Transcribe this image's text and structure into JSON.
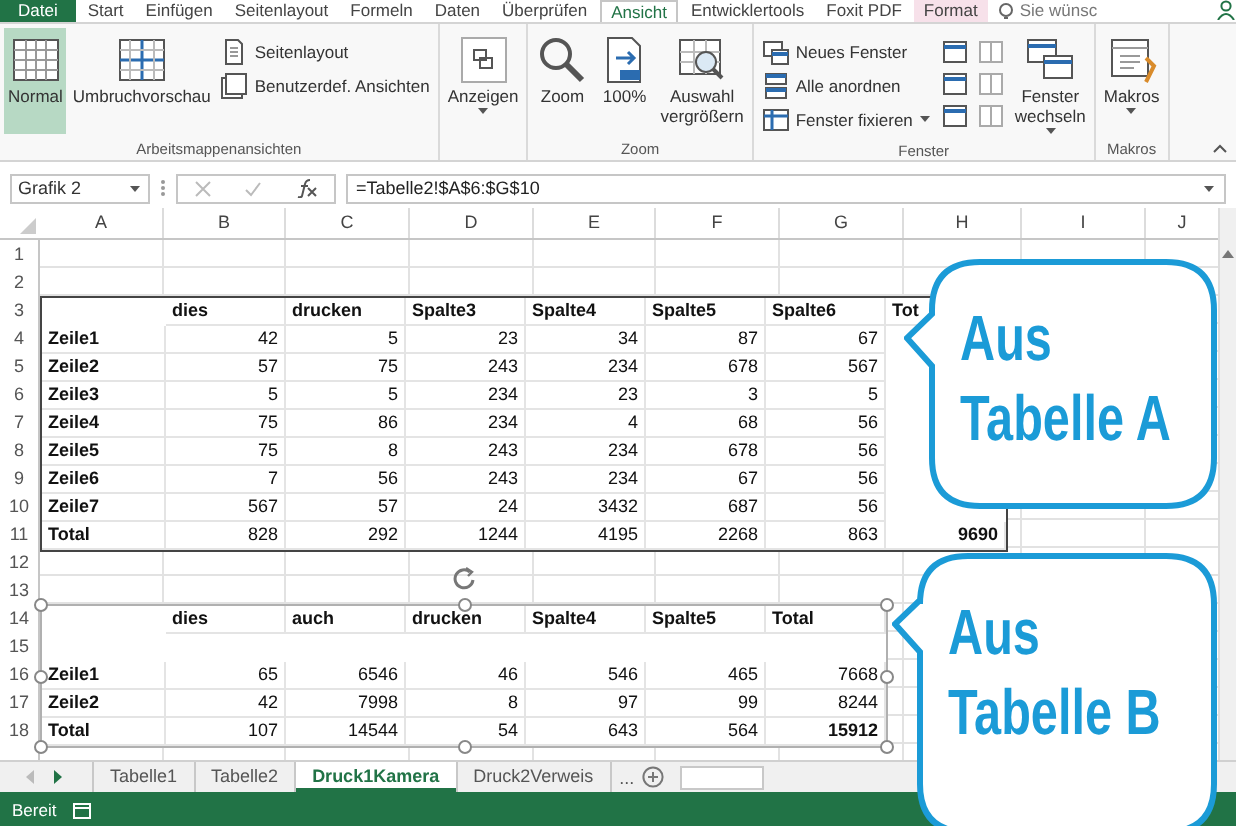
{
  "ribbon_tabs": [
    {
      "label": "Datei",
      "kind": "file",
      "selected": false
    },
    {
      "label": "Start",
      "kind": "normal",
      "selected": false
    },
    {
      "label": "Einfügen",
      "kind": "normal",
      "selected": false
    },
    {
      "label": "Seitenlayout",
      "kind": "normal",
      "selected": false
    },
    {
      "label": "Formeln",
      "kind": "normal",
      "selected": false
    },
    {
      "label": "Daten",
      "kind": "normal",
      "selected": false
    },
    {
      "label": "Überprüfen",
      "kind": "normal",
      "selected": false
    },
    {
      "label": "Ansicht",
      "kind": "normal",
      "selected": true
    },
    {
      "label": "Entwicklertools",
      "kind": "normal",
      "selected": false
    },
    {
      "label": "Foxit PDF",
      "kind": "normal",
      "selected": false
    },
    {
      "label": "Format",
      "kind": "contextual",
      "selected": false
    }
  ],
  "tell_me": {
    "placeholder": "Sie wünsc"
  },
  "ribbon_groups": [
    {
      "label": "Arbeitsmappenansichten",
      "buttons": [
        {
          "kind": "large",
          "label": "Normal",
          "selected": true
        },
        {
          "kind": "large",
          "label": "Umbruchvorschau",
          "selected": false
        },
        {
          "kind": "small",
          "label": "Seitenlayout",
          "selected": false
        },
        {
          "kind": "small",
          "label": "Benutzerdef. Ansichten",
          "selected": false
        }
      ]
    },
    {
      "buttons": [
        {
          "kind": "large",
          "label": "Anzeigen",
          "dropdown": true
        }
      ]
    },
    {
      "label": "Zoom",
      "buttons": [
        {
          "kind": "large",
          "label": "Zoom"
        },
        {
          "kind": "large",
          "label": "100%"
        },
        {
          "kind": "large",
          "label": "Auswahl vergrößern"
        }
      ]
    },
    {
      "label": "Fenster",
      "buttons": [
        {
          "kind": "small",
          "label": "Neues Fenster"
        },
        {
          "kind": "small",
          "label": "Alle anordnen"
        },
        {
          "kind": "small",
          "label": "Fenster fixieren",
          "dropdown": true
        },
        {
          "kind": "large",
          "label": "Fenster wechseln",
          "dropdown": true
        }
      ]
    },
    {
      "label": "Makros",
      "buttons": [
        {
          "kind": "large",
          "label": "Makros",
          "dropdown": true
        }
      ]
    }
  ],
  "formula_bar": {
    "name_box": "Grafik 2",
    "formula": "=Tabelle2!$A$6:$G$10"
  },
  "columns": [
    "A",
    "B",
    "C",
    "D",
    "E",
    "F",
    "G",
    "H",
    "I",
    "J"
  ],
  "row_numbers": [
    "1",
    "2",
    "3",
    "4",
    "5",
    "6",
    "7",
    "8",
    "9",
    "10",
    "11",
    "12",
    "13",
    "14",
    "15",
    "16",
    "17",
    "18"
  ],
  "pictures": [
    {
      "selected": false,
      "columns": [
        "dies",
        "drucken",
        "Spalte3",
        "Spalte4",
        "Spalte5",
        "Spalte6",
        "Tot"
      ],
      "rows": [
        {
          "kind": "data",
          "label": "Zeile1",
          "values": [
            "42",
            "5",
            "23",
            "34",
            "87",
            "67"
          ]
        },
        {
          "kind": "data",
          "label": "Zeile2",
          "values": [
            "57",
            "75",
            "243",
            "234",
            "678",
            "567"
          ]
        },
        {
          "kind": "data",
          "label": "Zeile3",
          "values": [
            "5",
            "5",
            "234",
            "23",
            "3",
            "5"
          ]
        },
        {
          "kind": "data",
          "label": "Zeile4",
          "values": [
            "75",
            "86",
            "234",
            "4",
            "68",
            "56"
          ]
        },
        {
          "kind": "data",
          "label": "Zeile5",
          "values": [
            "75",
            "8",
            "243",
            "234",
            "678",
            "56"
          ]
        },
        {
          "kind": "data",
          "label": "Zeile6",
          "values": [
            "7",
            "56",
            "243",
            "234",
            "67",
            "56"
          ]
        },
        {
          "kind": "data",
          "label": "Zeile7",
          "values": [
            "567",
            "57",
            "24",
            "3432",
            "687",
            "56"
          ]
        },
        {
          "kind": "total",
          "label": "Total",
          "values": [
            "828",
            "292",
            "1244",
            "4195",
            "2268",
            "863",
            "9690"
          ]
        }
      ]
    },
    {
      "selected": true,
      "columns": [
        "dies",
        "auch",
        "drucken",
        "Spalte4",
        "Spalte5",
        "Total"
      ],
      "rows": [
        {
          "kind": "spacer"
        },
        {
          "kind": "data",
          "label": "Zeile1",
          "values": [
            "65",
            "6546",
            "46",
            "546",
            "465",
            "7668"
          ]
        },
        {
          "kind": "data",
          "label": "Zeile2",
          "values": [
            "42",
            "7998",
            "8",
            "97",
            "99",
            "8244"
          ]
        },
        {
          "kind": "total",
          "label": "Total",
          "values": [
            "107",
            "14544",
            "54",
            "643",
            "564",
            "15912"
          ]
        }
      ]
    }
  ],
  "callouts": [
    {
      "text": "Aus Tabelle A"
    },
    {
      "text": "Aus Tabelle B"
    }
  ],
  "sheet_tabs": [
    {
      "label": "Tabelle1",
      "selected": false
    },
    {
      "label": "Tabelle2",
      "selected": false
    },
    {
      "label": "Druck1Kamera",
      "selected": true
    },
    {
      "label": "Druck2Verweis",
      "selected": false
    }
  ],
  "more_tabs": "...",
  "status_bar": {
    "text": "Bereit"
  }
}
